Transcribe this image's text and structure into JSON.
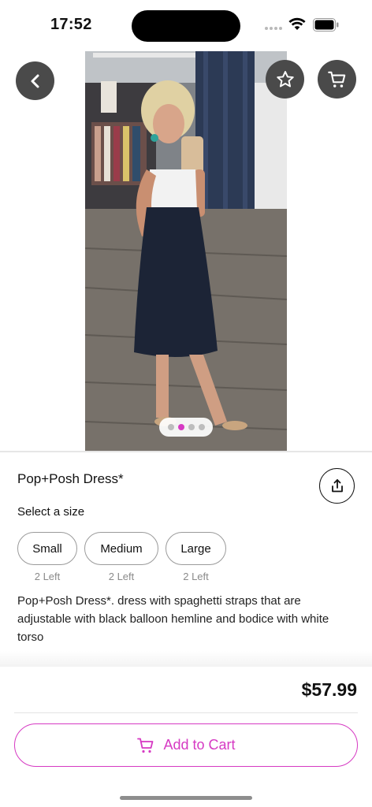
{
  "status_bar": {
    "time": "17:52"
  },
  "hero": {
    "icons": {
      "back": "chevron-left-icon",
      "favorite": "star-outline-icon",
      "cart": "cart-icon"
    },
    "carousel": {
      "pages": 4,
      "active_index": 1
    }
  },
  "product": {
    "title": "Pop+Posh  Dress*",
    "size_prompt": "Select a size",
    "sizes": [
      {
        "label": "Small",
        "stock": "2 Left"
      },
      {
        "label": "Medium",
        "stock": "2 Left"
      },
      {
        "label": "Large",
        "stock": "2 Left"
      }
    ],
    "description": "Pop+Posh  Dress*. dress with spaghetti straps that are adjustable with black balloon hemline and bodice with white torso"
  },
  "purchase": {
    "price": "$57.99",
    "add_to_cart_label": "Add to Cart"
  },
  "colors": {
    "accent": "#d63ac3",
    "nav_button_bg": "#4a4a4a"
  }
}
